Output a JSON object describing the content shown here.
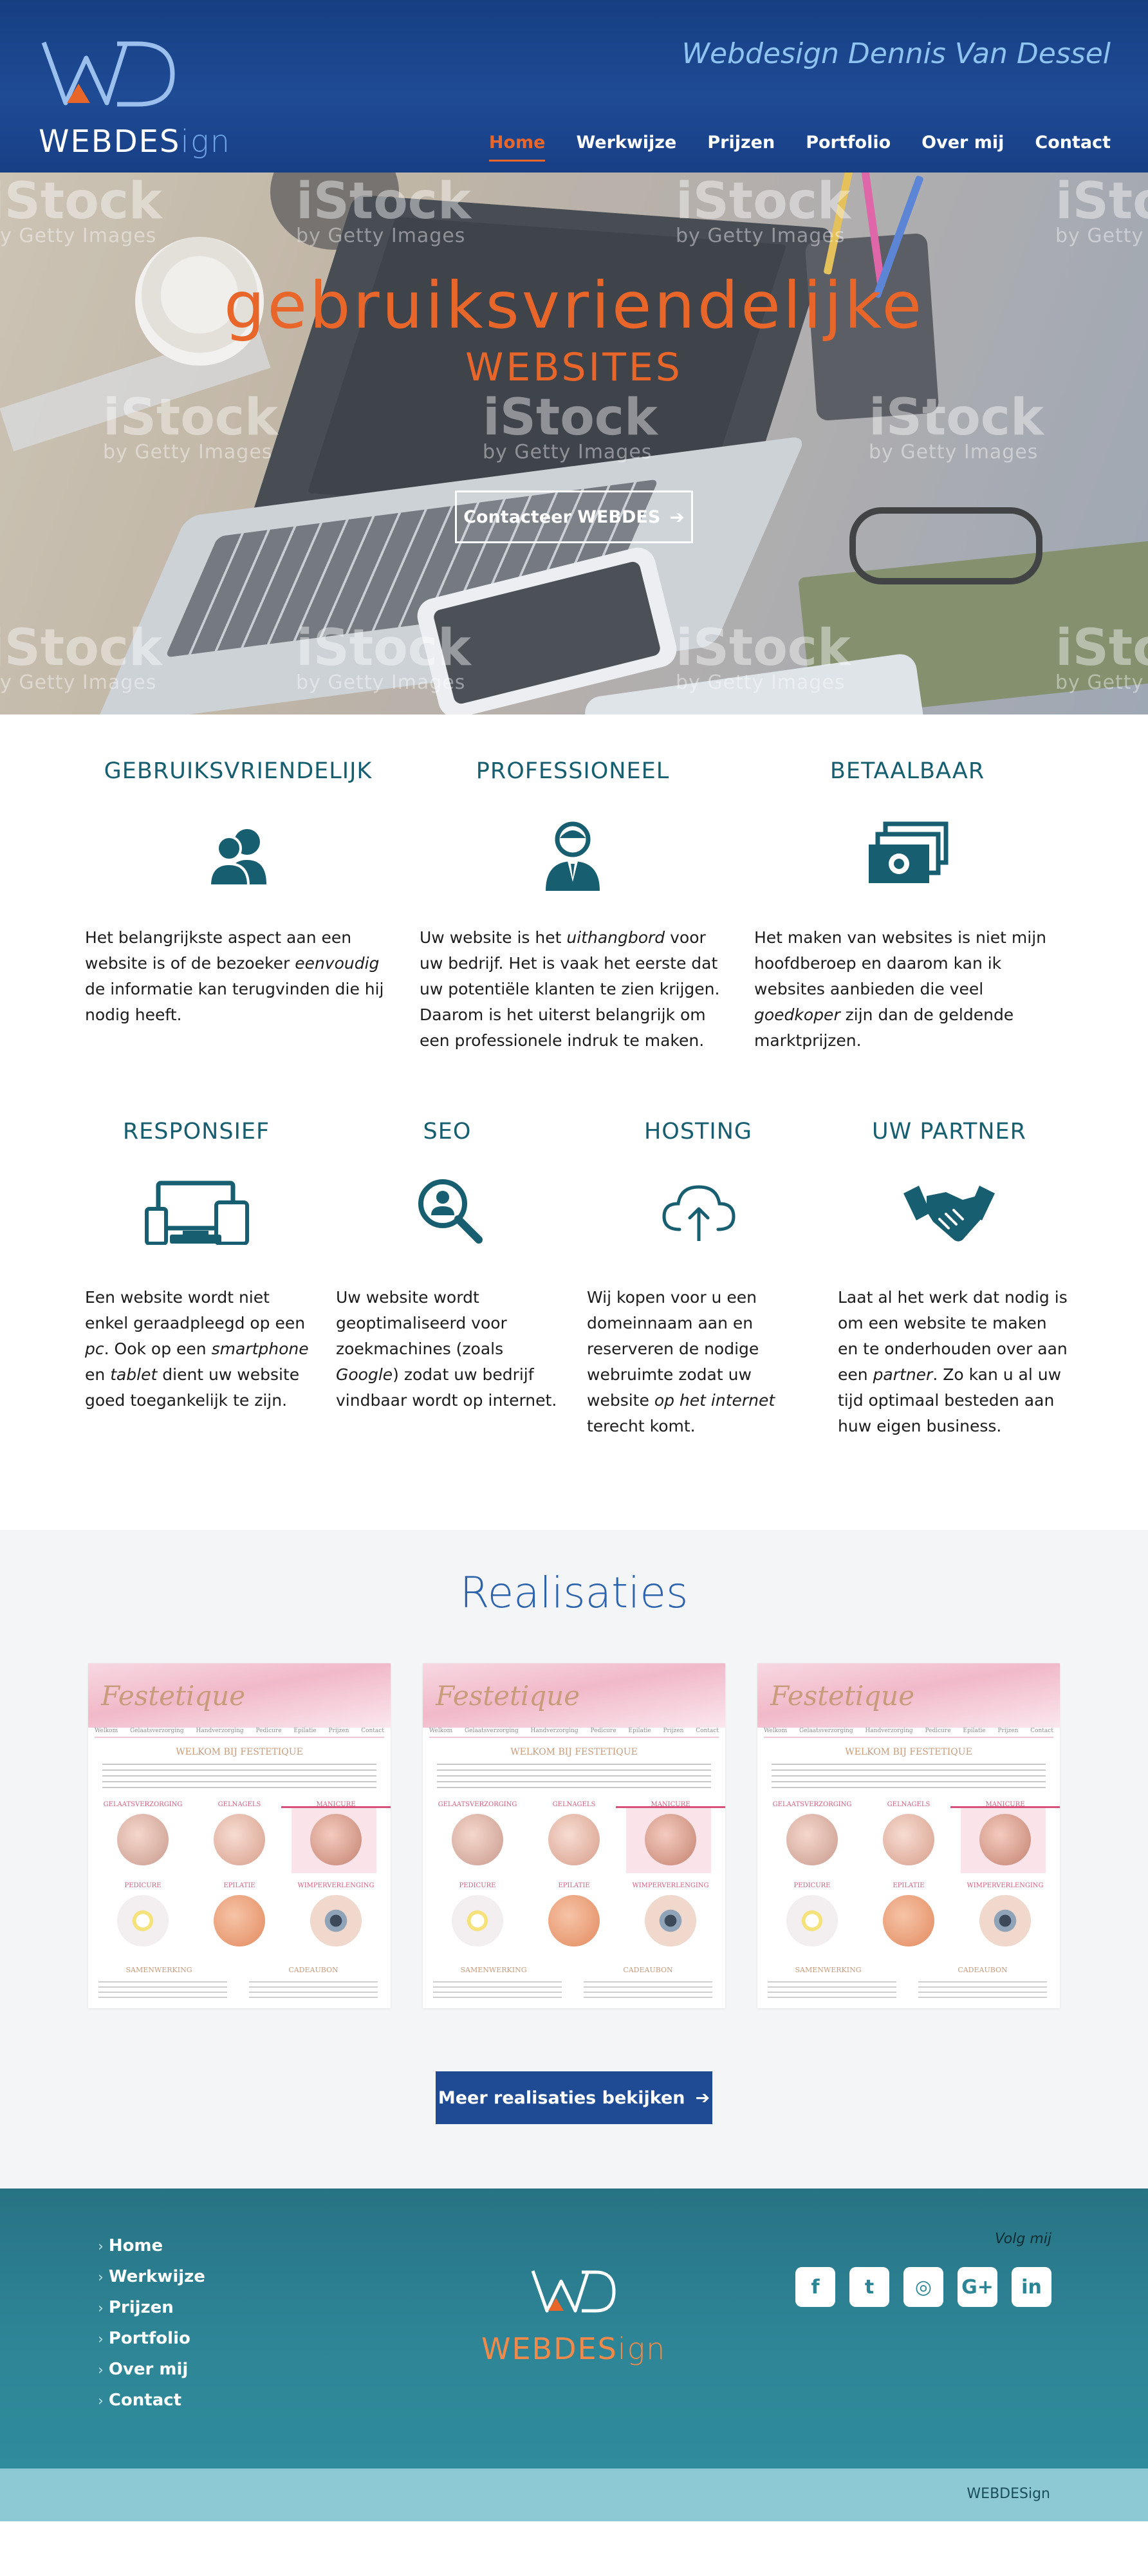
{
  "header": {
    "logo_main": "WEBDES",
    "logo_suffix": "ign",
    "tagline": "Webdesign Dennis Van Dessel",
    "nav": [
      {
        "label": "Home",
        "active": true
      },
      {
        "label": "Werkwijze"
      },
      {
        "label": "Prijzen"
      },
      {
        "label": "Portfolio"
      },
      {
        "label": "Over mij"
      },
      {
        "label": "Contact"
      }
    ]
  },
  "hero": {
    "title": "gebruiksvriendelijke",
    "subtitle": "WEBSITES",
    "cta_label": "Contacteer WEBDES",
    "watermark_brand": "iStock",
    "watermark_sub": "by Getty Images"
  },
  "features_top": [
    {
      "title": "GEBRUIKSVRIENDELIJK",
      "icon": "users-icon",
      "text_parts": [
        "Het belangrijkste aspect aan een website is of de bezoeker ",
        "eenvoudig",
        " de informatie kan terugvinden die hij nodig heeft."
      ]
    },
    {
      "title": "PROFESSIONEEL",
      "icon": "businessman-icon",
      "text_parts": [
        "Uw website is het ",
        "uithangbord",
        " voor uw bedrijf. Het is vaak het eerste dat uw potentiële klanten te zien krijgen. Daarom is het uiterst belangrijk om een professionele indruk te maken."
      ]
    },
    {
      "title": "BETAALBAAR",
      "icon": "money-icon",
      "text_parts": [
        "Het maken van websites is niet mijn hoofdberoep en daarom kan ik websites aanbieden die veel ",
        "goedkoper",
        " zijn dan de geldende marktprijzen."
      ]
    }
  ],
  "features_bottom": [
    {
      "title": "RESPONSIEF",
      "icon": "devices-icon",
      "text_parts": [
        "Een website wordt niet enkel geraadpleegd op een ",
        "pc",
        ". Ook op een ",
        "smartphone",
        " en ",
        "tablet",
        " dient uw website goed toegankelijk te zijn."
      ]
    },
    {
      "title": "SEO",
      "icon": "search-user-icon",
      "text_parts": [
        "Uw website wordt geoptimaliseerd voor zoekmachines (zoals ",
        "Google",
        ") zodat uw bedrijf vindbaar wordt op internet."
      ]
    },
    {
      "title": "HOSTING",
      "icon": "cloud-upload-icon",
      "text_parts": [
        "Wij kopen voor u een domeinnaam aan en reserveren de nodige webruimte zodat uw website ",
        "op het internet",
        " terecht komt."
      ]
    },
    {
      "title": "UW PARTNER",
      "icon": "handshake-icon",
      "text_parts": [
        "Laat al het werk dat nodig is om een website te maken en te onderhouden over aan een ",
        "partner",
        ". Zo kan u al uw tijd optimaal besteden aan huw eigen business."
      ]
    }
  ],
  "realisaties": {
    "title": "Realisaties",
    "thumb_logo": "Festetique",
    "thumb_heading": "WELKOM BIJ FESTETIQUE",
    "thumb_nav": [
      "Welkom",
      "Gelaatsverzorging",
      "Handverzorging",
      "Pedicure",
      "Epilatie",
      "Prijzen",
      "Contact"
    ],
    "thumb_captions": [
      "GELAATSVERZORGING",
      "GELNAGELS",
      "MANICURE",
      "PEDICURE",
      "EPILATIE",
      "WIMPERVERLENGING"
    ],
    "thumb_footers": [
      "SAMENWERKING",
      "CADEAUBON"
    ],
    "more_label": "Meer realisaties bekijken"
  },
  "footer": {
    "links": [
      "Home",
      "Werkwijze",
      "Prijzen",
      "Portfolio",
      "Over mij",
      "Contact"
    ],
    "logo_main": "WEBDES",
    "logo_suffix": "ign",
    "follow_label": "Volg mij",
    "socials": [
      {
        "icon": "facebook-icon",
        "glyph": "f"
      },
      {
        "icon": "twitter-icon",
        "glyph": "t"
      },
      {
        "icon": "instagram-icon",
        "glyph": "◎"
      },
      {
        "icon": "google-plus-icon",
        "glyph": "G+"
      },
      {
        "icon": "linkedin-icon",
        "glyph": "in"
      }
    ],
    "bottom_text": "WEBDESign"
  },
  "colors": {
    "header_blue": "#1f4b95",
    "accent_orange": "#e8662a",
    "teal_heading": "#175f70",
    "realisaties_blue": "#2c63ad",
    "footer_teal": "#2d8495",
    "bottom_bar": "#8cc9d4"
  }
}
